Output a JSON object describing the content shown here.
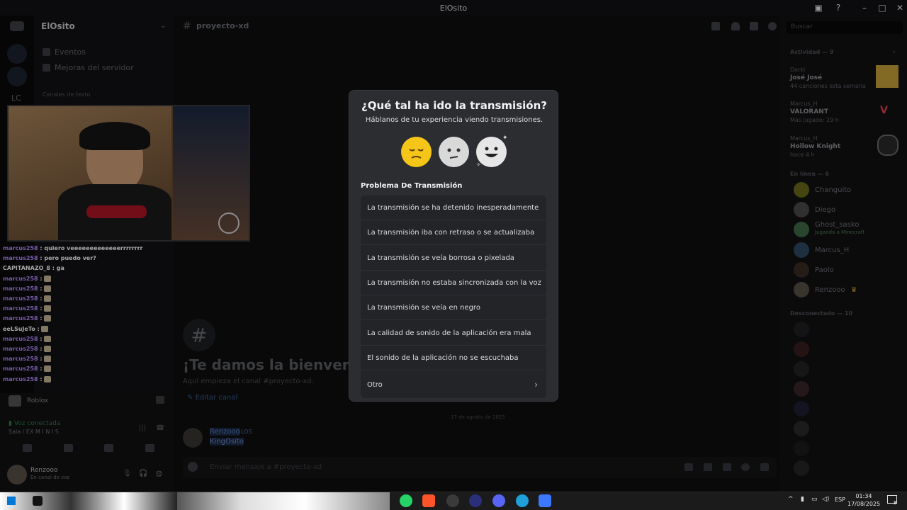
{
  "window": {
    "title": "ElOsito",
    "min": "–",
    "max": "□",
    "close": "✕"
  },
  "server": {
    "name": "ElOsito",
    "rail_label": "LC"
  },
  "sidebar": {
    "items": [
      {
        "label": "Eventos"
      },
      {
        "label": "Mejoras del servidor"
      }
    ],
    "section": "Canales de texto"
  },
  "channel": {
    "name": "proyecto-xd"
  },
  "chat": [
    {
      "user": "marcus258",
      "text": ": quiero veeeeeeeeeeeeerrrrrrrr"
    },
    {
      "user": "marcus258",
      "text": ": pero puedo ver?"
    },
    {
      "user": "CAPITANAZO_8",
      "text": ": ga"
    },
    {
      "user": "marcus258",
      "text": ":"
    },
    {
      "user": "marcus258",
      "text": ":"
    },
    {
      "user": "marcus258",
      "text": ":"
    },
    {
      "user": "marcus258",
      "text": ":"
    },
    {
      "user": "marcus258",
      "text": ":"
    },
    {
      "user": "eeLSuJeTo",
      "text": ":"
    },
    {
      "user": "marcus258",
      "text": ":"
    },
    {
      "user": "marcus258",
      "text": ":"
    },
    {
      "user": "marcus258",
      "text": ":"
    },
    {
      "user": "marcus258",
      "text": ":"
    },
    {
      "user": "marcus258",
      "text": ":"
    }
  ],
  "userpanel": {
    "game": "Roblox",
    "voice_status": "Voz conectada",
    "voice_room": "Sala / EX M I N I S",
    "username": "Renzooo",
    "user_status": "En canal de voz"
  },
  "main": {
    "hash": "#",
    "welcome": "¡Te damos la bienvenida a",
    "welcome_sub": "Aquí empieza el canal #proyecto-xd.",
    "edit_channel": "Editar canal",
    "date": "17 de agosto de 2025",
    "message_user": "Renzooo",
    "message_tag": "LOS",
    "message_text": "KingOsito",
    "composer_placeholder": "Enviar mensaje a #proyecto-xd"
  },
  "members": {
    "search_placeholder": "Buscar",
    "activity_header": "Actividad — 9",
    "activities": [
      {
        "user": "Darki",
        "title": "José José",
        "detail": "44 canciones esta semana"
      },
      {
        "user": "Marcus_H",
        "title": "VALORANT",
        "detail": "Más jugado: 29 h"
      },
      {
        "user": "Marcus_H",
        "title": "Hollow Knight",
        "detail": "hace 4 h"
      }
    ],
    "online_header": "En línea — 6",
    "online": [
      {
        "name": "Changuito"
      },
      {
        "name": "Diego"
      },
      {
        "name": "Ghost_sasko",
        "sub": "Jugando a Minecraft"
      },
      {
        "name": "Marcus_H"
      },
      {
        "name": "Paolo"
      },
      {
        "name": "Renzooo"
      }
    ],
    "offline_header": "Desconectado — 10"
  },
  "modal": {
    "title": "¿Qué tal ha ido la transmisión?",
    "subtitle": "Háblanos de tu experiencia viendo transmisiones.",
    "section": "Problema De Transmisión",
    "options": [
      "La transmisión se ha detenido inesperadamente",
      "La transmisión iba con retraso o se actualizaba",
      "La transmisión se veía borrosa o pixelada",
      "La transmisión no estaba sincronizada con la voz",
      "La transmisión se veía en negro",
      "La calidad de sonido de la aplicación era mala",
      "El sonido de la aplicación no se escuchaba",
      "Otro"
    ],
    "colors": {
      "sad": "#f5c518",
      "neutral": "#d9d9d9",
      "happy": "#e6e6e6"
    }
  },
  "taskbar": {
    "lang": "ESP",
    "time": "01:34",
    "date": "17/08/2025",
    "notif_count": "8"
  }
}
